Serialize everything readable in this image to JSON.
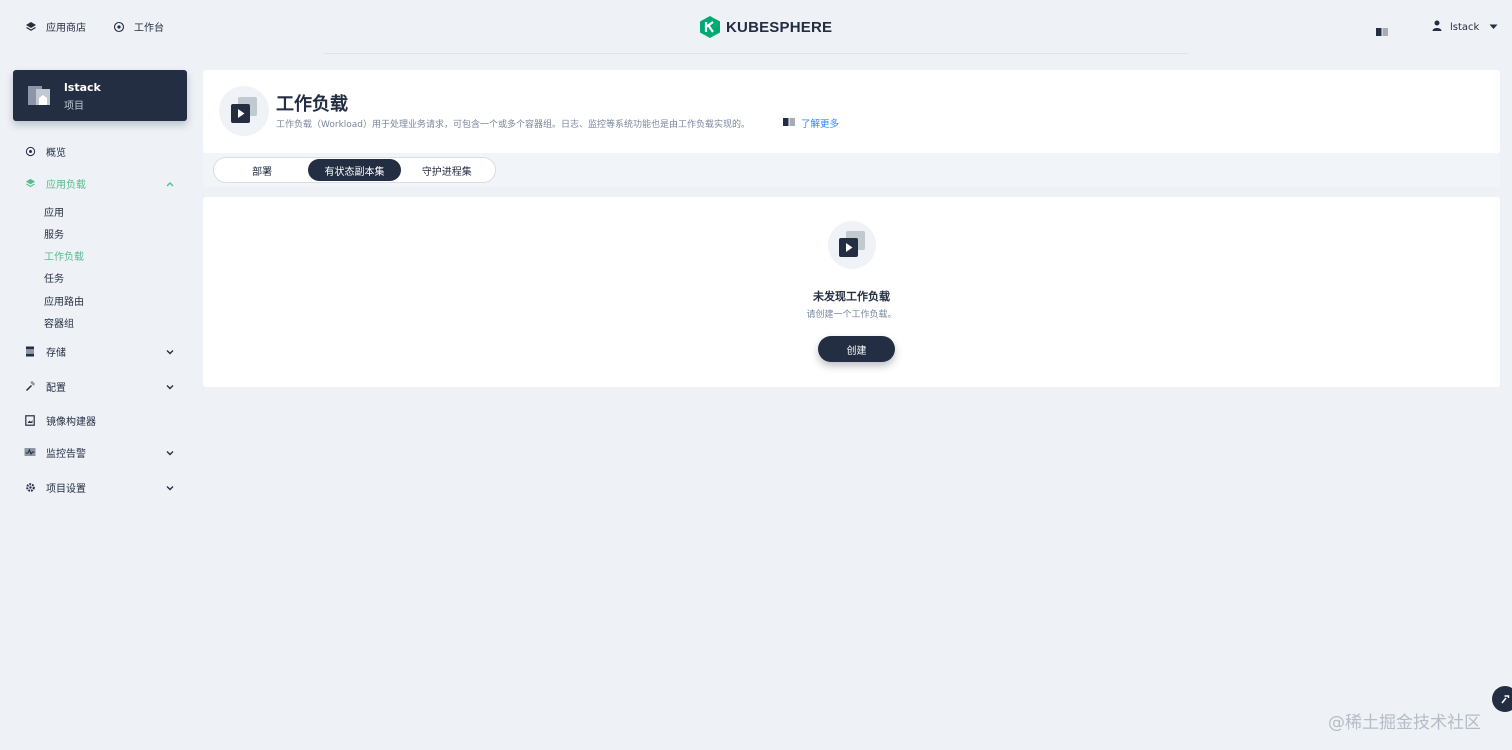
{
  "topbar": {
    "app_store": "应用商店",
    "workbench": "工作台",
    "logo_text": "KUBESPHERE",
    "user_name": "lstack"
  },
  "project": {
    "name": "lstack",
    "type": "项目"
  },
  "sidebar": {
    "overview": "概览",
    "app_workloads": "应用负载",
    "sub_items": [
      "应用",
      "服务",
      "工作负载",
      "任务",
      "应用路由",
      "容器组"
    ],
    "storage": "存储",
    "config": "配置",
    "image_builder": "镜像构建器",
    "monitoring": "监控告警",
    "project_settings": "项目设置"
  },
  "header": {
    "title": "工作负载",
    "description": "工作负载（Workload）用于处理业务请求，可包含一个或多个容器组。日志、监控等系统功能也是由工作负载实现的。",
    "learn_more": "了解更多"
  },
  "tabs": [
    {
      "label": "部署",
      "active": false
    },
    {
      "label": "有状态副本集",
      "active": true
    },
    {
      "label": "守护进程集",
      "active": false
    }
  ],
  "empty": {
    "title": "未发现工作负载",
    "description": "请创建一个工作负载。",
    "create_label": "创建"
  },
  "watermark": "@稀土掘金技术社区",
  "colors": {
    "primary_dark": "#242e42",
    "accent_green": "#55bc8a",
    "link_blue": "#3385ff",
    "background": "#eef2f7"
  }
}
